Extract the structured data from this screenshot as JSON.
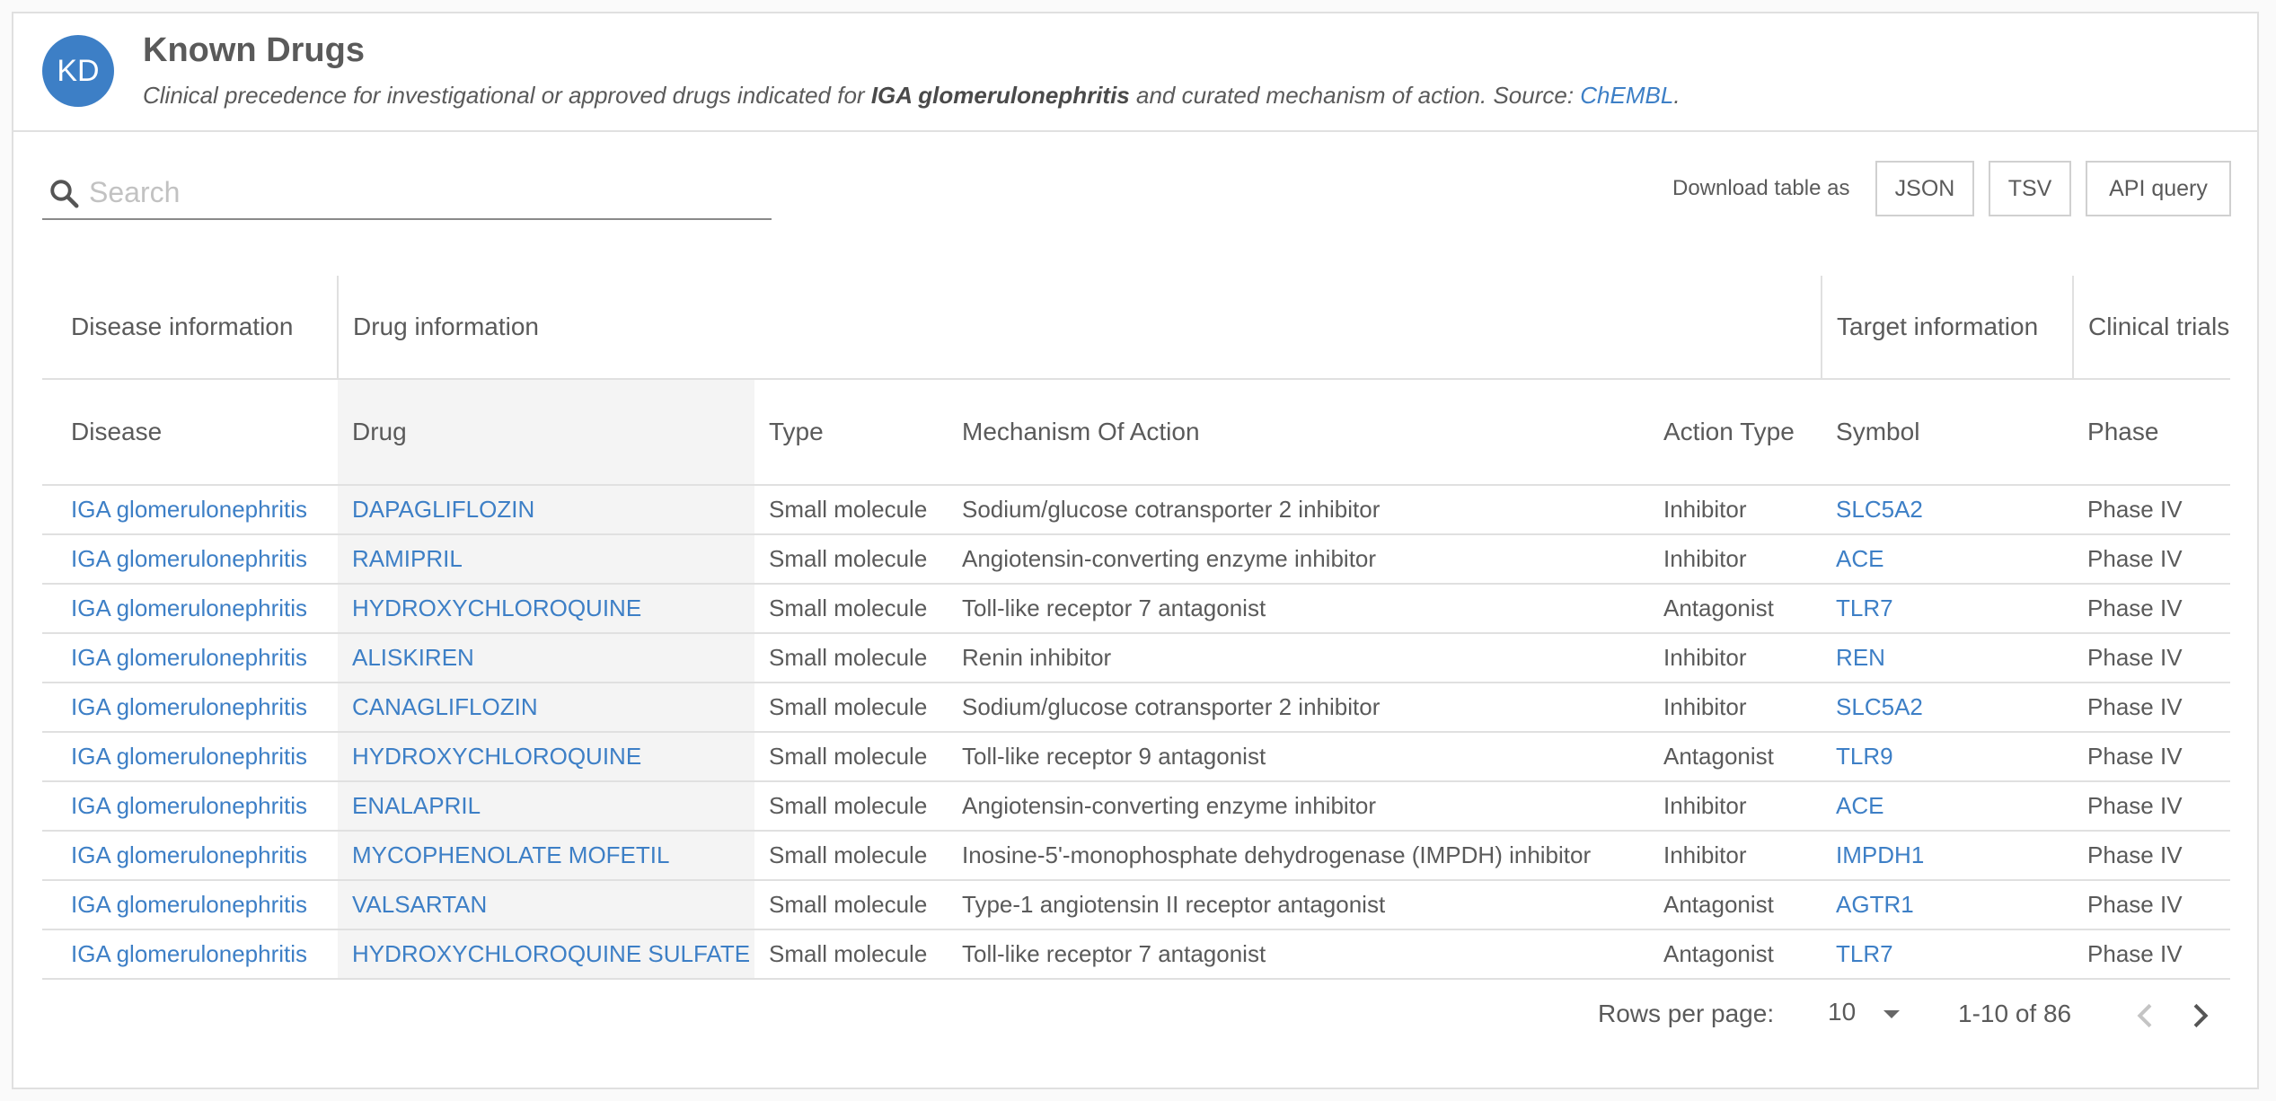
{
  "header": {
    "avatar_initials": "KD",
    "title": "Known Drugs",
    "subtitle_prefix": "Clinical precedence for investigational or approved drugs indicated for",
    "subtitle_disease": "IGA glomerulonephritis",
    "subtitle_middle": "and curated mechanism of action. Source:",
    "subtitle_source": "ChEMBL",
    "subtitle_end": "."
  },
  "search": {
    "placeholder": "Search",
    "value": ""
  },
  "download": {
    "label": "Download table as",
    "buttons": [
      "JSON",
      "TSV",
      "API query"
    ]
  },
  "table": {
    "groups": [
      "Disease information",
      "Drug information",
      "Target information",
      "Clinical trials"
    ],
    "columns": [
      "Disease",
      "Drug",
      "Type",
      "Mechanism Of Action",
      "Action Type",
      "Symbol",
      "Phase"
    ],
    "rows": [
      {
        "disease": "IGA glomerulonephritis",
        "drug": "DAPAGLIFLOZIN",
        "type": "Small molecule",
        "moa": "Sodium/glucose cotransporter 2 inhibitor",
        "action": "Inhibitor",
        "symbol": "SLC5A2",
        "phase": "Phase IV"
      },
      {
        "disease": "IGA glomerulonephritis",
        "drug": "RAMIPRIL",
        "type": "Small molecule",
        "moa": "Angiotensin-converting enzyme inhibitor",
        "action": "Inhibitor",
        "symbol": "ACE",
        "phase": "Phase IV"
      },
      {
        "disease": "IGA glomerulonephritis",
        "drug": "HYDROXYCHLOROQUINE",
        "type": "Small molecule",
        "moa": "Toll-like receptor 7 antagonist",
        "action": "Antagonist",
        "symbol": "TLR7",
        "phase": "Phase IV"
      },
      {
        "disease": "IGA glomerulonephritis",
        "drug": "ALISKIREN",
        "type": "Small molecule",
        "moa": "Renin inhibitor",
        "action": "Inhibitor",
        "symbol": "REN",
        "phase": "Phase IV"
      },
      {
        "disease": "IGA glomerulonephritis",
        "drug": "CANAGLIFLOZIN",
        "type": "Small molecule",
        "moa": "Sodium/glucose cotransporter 2 inhibitor",
        "action": "Inhibitor",
        "symbol": "SLC5A2",
        "phase": "Phase IV"
      },
      {
        "disease": "IGA glomerulonephritis",
        "drug": "HYDROXYCHLOROQUINE",
        "type": "Small molecule",
        "moa": "Toll-like receptor 9 antagonist",
        "action": "Antagonist",
        "symbol": "TLR9",
        "phase": "Phase IV"
      },
      {
        "disease": "IGA glomerulonephritis",
        "drug": "ENALAPRIL",
        "type": "Small molecule",
        "moa": "Angiotensin-converting enzyme inhibitor",
        "action": "Inhibitor",
        "symbol": "ACE",
        "phase": "Phase IV"
      },
      {
        "disease": "IGA glomerulonephritis",
        "drug": "MYCOPHENOLATE MOFETIL",
        "type": "Small molecule",
        "moa": "Inosine-5'-monophosphate dehydrogenase (IMPDH) inhibitor",
        "action": "Inhibitor",
        "symbol": "IMPDH1",
        "phase": "Phase IV"
      },
      {
        "disease": "IGA glomerulonephritis",
        "drug": "VALSARTAN",
        "type": "Small molecule",
        "moa": "Type-1 angiotensin II receptor antagonist",
        "action": "Antagonist",
        "symbol": "AGTR1",
        "phase": "Phase IV"
      },
      {
        "disease": "IGA glomerulonephritis",
        "drug": "HYDROXYCHLOROQUINE SULFATE",
        "type": "Small molecule",
        "moa": "Toll-like receptor 7 antagonist",
        "action": "Antagonist",
        "symbol": "TLR7",
        "phase": "Phase IV"
      }
    ]
  },
  "pagination": {
    "rows_label": "Rows per page:",
    "rows_value": "10",
    "range": "1-10 of 86"
  },
  "colors": {
    "accent": "#3d7fc6",
    "border": "#e0e0e0",
    "text": "#5a5a5a"
  },
  "icons": [
    "search-icon",
    "caret-down-icon",
    "chevron-left-icon",
    "chevron-right-icon"
  ]
}
